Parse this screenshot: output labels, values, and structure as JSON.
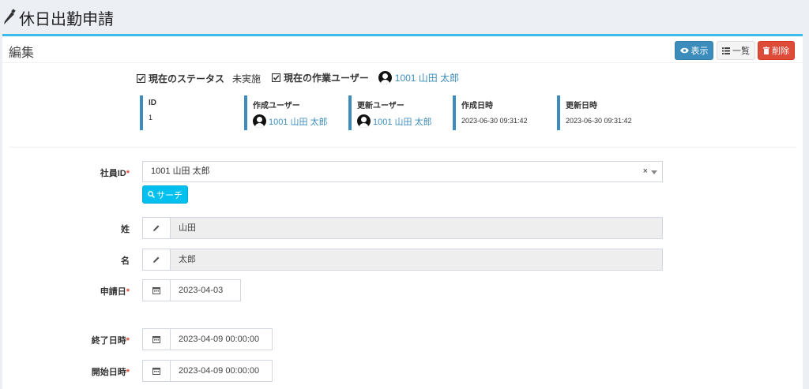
{
  "page": {
    "title": "休日出勤申請"
  },
  "box": {
    "title": "編集",
    "buttons": {
      "view": "表示",
      "list": "一覧",
      "delete": "削除"
    }
  },
  "status": {
    "status_label": "現在のステータス",
    "status_value": "未実施",
    "worker_label": "現在の作業ユーザー",
    "worker_value": "1001 山田 太郎"
  },
  "meta": {
    "id": {
      "label": "ID",
      "value": "1"
    },
    "created_by": {
      "label": "作成ユーザー",
      "value": "1001 山田 太郎"
    },
    "updated_by": {
      "label": "更新ユーザー",
      "value": "1001 山田 太郎"
    },
    "created_at": {
      "label": "作成日時",
      "value": "2023-06-30 09:31:42"
    },
    "updated_at": {
      "label": "更新日時",
      "value": "2023-06-30 09:31:42"
    }
  },
  "form": {
    "employee_id": {
      "label": "社員ID",
      "value": "1001 山田 太郎",
      "clear": "×"
    },
    "search_button": "サーチ",
    "last_name": {
      "label": "姓",
      "value": "山田"
    },
    "first_name": {
      "label": "名",
      "value": "太郎"
    },
    "apply_date": {
      "label": "申請日",
      "value": "2023-04-03"
    },
    "end_datetime": {
      "label": "終了日時",
      "value": "2023-04-09 00:00:00"
    },
    "start_datetime": {
      "label": "開始日時",
      "value": "2023-04-09 00:00:00"
    },
    "required_mark": "*"
  },
  "colors": {
    "primary": "#3c8dbc",
    "accent_top": "#3cbcec",
    "danger": "#dd4b39",
    "info": "#00c0ef"
  }
}
